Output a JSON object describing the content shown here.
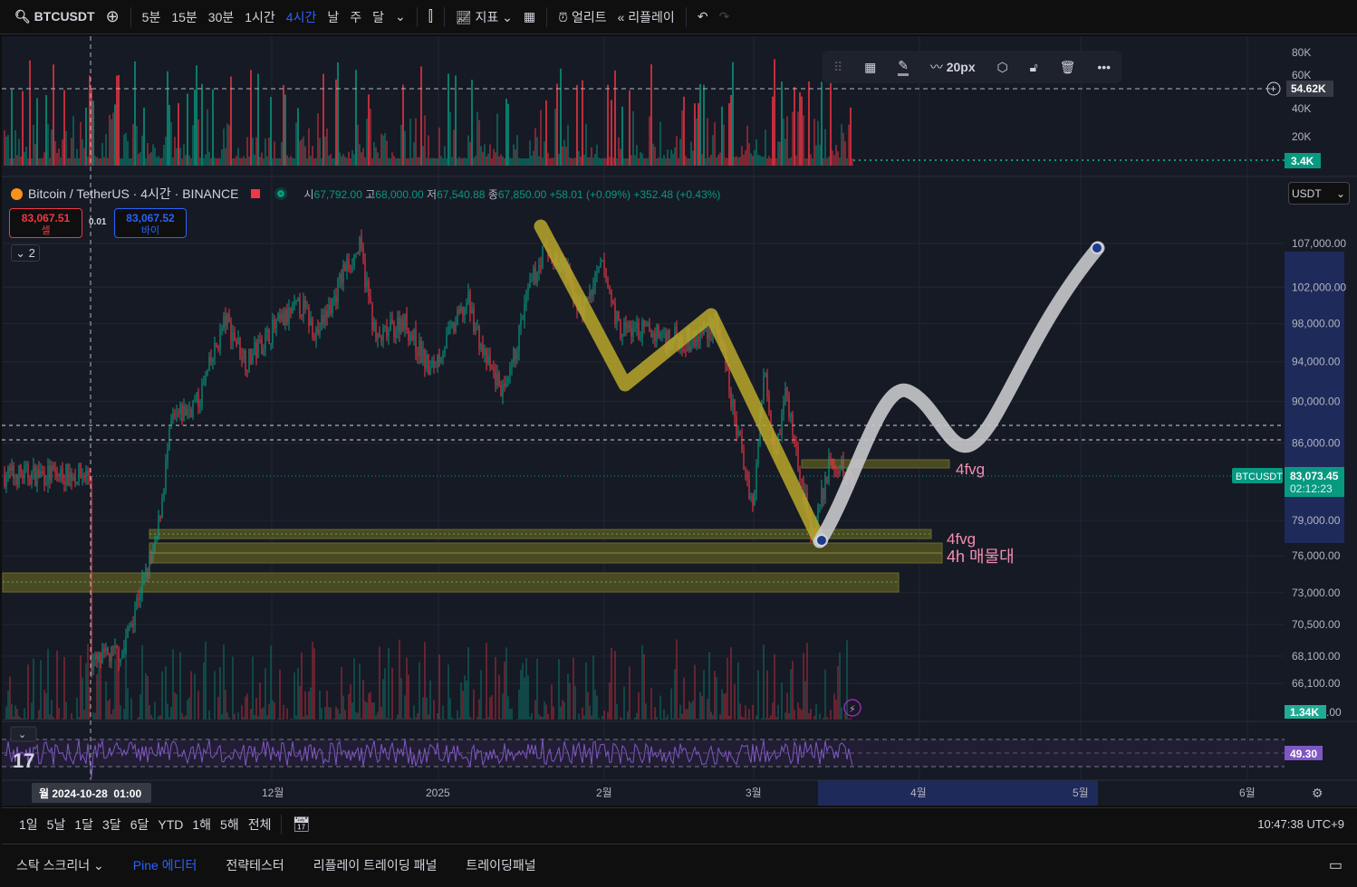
{
  "toolbar": {
    "symbol": "BTCUSDT",
    "intervals": [
      "5분",
      "15분",
      "30분",
      "1시간",
      "4시간",
      "날",
      "주",
      "달"
    ],
    "active_interval": "4시간",
    "indicators": "지표",
    "alert": "얼리트",
    "replay": "리플레이"
  },
  "drawing_toolbar": {
    "width_label": "20px"
  },
  "legend": {
    "title": "Bitcoin / TetherUS · 4시간 · BINANCE",
    "o_label": "시",
    "o": "67,792.00",
    "h_label": "고",
    "h": "68,000.00",
    "l_label": "저",
    "l": "67,540.88",
    "c_label": "종",
    "c": "67,850.00",
    "chg": "+58.01 (+0.09%)",
    "chg2": "+352.48 (+0.43%)"
  },
  "trade": {
    "sell_price": "83,067.51",
    "sell_label": "셀",
    "spread": "0.01",
    "buy_price": "83,067.52",
    "buy_label": "바이",
    "collapse_count": "2"
  },
  "currency": "USDT",
  "volume_axis": {
    "ticks": [
      "80K",
      "60K",
      "40K",
      "20K"
    ],
    "crosshair": "54.62K",
    "last": "3.4K"
  },
  "price_axis": {
    "ticks": [
      {
        "v": 107000,
        "t": "107,000.00"
      },
      {
        "v": 102000,
        "t": "102,000.00"
      },
      {
        "v": 98000,
        "t": "98,000.00"
      },
      {
        "v": 94000,
        "t": "94,000.00"
      },
      {
        "v": 90000,
        "t": "90,000.00"
      },
      {
        "v": 86000,
        "t": "86,000.00"
      },
      {
        "v": 79000,
        "t": "79,000.00"
      },
      {
        "v": 76000,
        "t": "76,000.00"
      },
      {
        "v": 73000,
        "t": "73,000.00"
      },
      {
        "v": 70500,
        "t": "70,500.00"
      },
      {
        "v": 68100,
        "t": "68,100.00"
      },
      {
        "v": 66100,
        "t": "66,100.00"
      }
    ],
    "symbol_tag": "BTCUSDT",
    "last_price": "83,073.45",
    "countdown": "02:12:23",
    "volume_tag": "1.34K",
    "volume_tag_suffix": ".00"
  },
  "rsi": {
    "value": "49.30"
  },
  "time_axis": {
    "crosshair": "월 2024-10-28  01:00",
    "labels": [
      "12월",
      "2025",
      "2월",
      "3월",
      "4월",
      "5월",
      "6월"
    ]
  },
  "annotations": {
    "fvg1": "4fvg",
    "fvg2": "4fvg",
    "supply": "4h 매물대"
  },
  "range_bar": {
    "items": [
      "1일",
      "5날",
      "1달",
      "3달",
      "6달",
      "YTD",
      "1해",
      "5해",
      "전체"
    ],
    "clock": "10:47:38 UTC+9"
  },
  "bottom_tabs": {
    "items": [
      "스탁 스크리너",
      "Pine 에디터",
      "전략테스터",
      "리플레이 트레이딩 패널",
      "트레이딩패널"
    ]
  },
  "colors": {
    "up": "#089981",
    "down": "#f23645",
    "accent": "#2962ff",
    "rsi": "#7e57c2",
    "highlight": "#b8a82a"
  },
  "chart_data": {
    "type": "candlestick",
    "scale": "log",
    "ylim": [
      62000,
      112000
    ],
    "keypoints": [
      [
        "2024-10-28",
        67500
      ],
      [
        "2024-11-03",
        68500
      ],
      [
        "2024-11-06",
        73000
      ],
      [
        "2024-11-09",
        76500
      ],
      [
        "2024-11-12",
        88000
      ],
      [
        "2024-11-17",
        90000
      ],
      [
        "2024-11-22",
        98500
      ],
      [
        "2024-11-26",
        94000
      ],
      [
        "2024-12-01",
        97500
      ],
      [
        "2024-12-06",
        100000
      ],
      [
        "2024-12-09",
        97000
      ],
      [
        "2024-12-12",
        100500
      ],
      [
        "2024-12-14",
        104000
      ],
      [
        "2024-12-17",
        106500
      ],
      [
        "2024-12-20",
        96000
      ],
      [
        "2024-12-25",
        98500
      ],
      [
        "2024-12-30",
        93000
      ],
      [
        "2025-01-06",
        100500
      ],
      [
        "2025-01-09",
        94500
      ],
      [
        "2025-01-13",
        90500
      ],
      [
        "2025-01-17",
        101000
      ],
      [
        "2025-01-20",
        106000
      ],
      [
        "2025-01-24",
        104000
      ],
      [
        "2025-01-27",
        99000
      ],
      [
        "2025-01-31",
        104500
      ],
      [
        "2025-02-03",
        97500
      ],
      [
        "2025-02-10",
        97000
      ],
      [
        "2025-02-17",
        96000
      ],
      [
        "2025-02-21",
        98500
      ],
      [
        "2025-02-25",
        87000
      ],
      [
        "2025-02-28",
        80000
      ],
      [
        "2025-03-02",
        94000
      ],
      [
        "2025-03-04",
        85000
      ],
      [
        "2025-03-06",
        91000
      ],
      [
        "2025-03-09",
        82000
      ],
      [
        "2025-03-11",
        77500
      ],
      [
        "2025-03-14",
        84000
      ],
      [
        "2025-03-18",
        83073
      ]
    ]
  }
}
